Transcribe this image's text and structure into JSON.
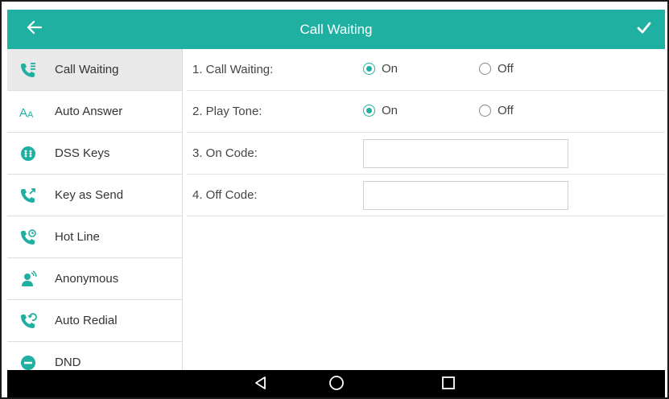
{
  "header": {
    "title": "Call Waiting",
    "back_icon": "back-arrow-icon",
    "confirm_icon": "checkmark-icon"
  },
  "sidebar": {
    "items": [
      {
        "label": "Call Waiting",
        "icon": "call-waiting-icon",
        "active": true
      },
      {
        "label": "Auto Answer",
        "icon": "auto-answer-icon",
        "active": false
      },
      {
        "label": "DSS Keys",
        "icon": "dss-keys-icon",
        "active": false
      },
      {
        "label": "Key as Send",
        "icon": "key-as-send-icon",
        "active": false
      },
      {
        "label": "Hot Line",
        "icon": "hot-line-icon",
        "active": false
      },
      {
        "label": "Anonymous",
        "icon": "anonymous-icon",
        "active": false
      },
      {
        "label": "Auto Redial",
        "icon": "auto-redial-icon",
        "active": false
      },
      {
        "label": "DND",
        "icon": "dnd-icon",
        "active": false
      }
    ]
  },
  "settings": {
    "call_waiting": {
      "label": "1. Call Waiting:",
      "on_label": "On",
      "off_label": "Off",
      "selected": "On"
    },
    "play_tone": {
      "label": "2. Play Tone:",
      "on_label": "On",
      "off_label": "Off",
      "selected": "On"
    },
    "on_code": {
      "label": "3. On Code:",
      "value": ""
    },
    "off_code": {
      "label": "4. Off Code:",
      "value": ""
    }
  },
  "navbar": {
    "back_icon": "nav-back-triangle-icon",
    "home_icon": "nav-home-circle-icon",
    "recents_icon": "nav-recents-square-icon"
  },
  "colors": {
    "accent": "#1fb0a2",
    "header_bg": "#1fb0a2",
    "sidebar_active_bg": "#e9e9e9",
    "navbar_bg": "#000000"
  }
}
